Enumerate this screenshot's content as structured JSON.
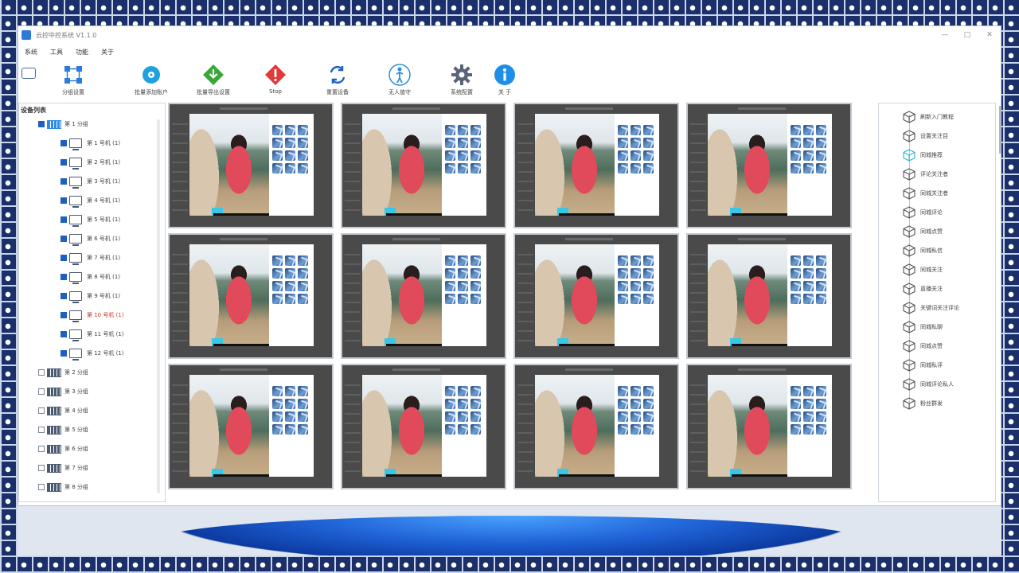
{
  "window": {
    "title": "云控中控系统 V1.1.0",
    "controls": [
      "—",
      "□",
      "✕"
    ]
  },
  "menu": [
    "系统",
    "工具",
    "功能",
    "关于"
  ],
  "toolbar": [
    {
      "id": "group",
      "label": "分组设置",
      "icon": "network-icon",
      "color": "#2d7bd8"
    },
    {
      "id": "batch-add",
      "label": "批量添加账户",
      "icon": "disc-icon",
      "color": "#1fa0e0"
    },
    {
      "id": "batch-export",
      "label": "批量导出设置",
      "icon": "download-diamond-icon",
      "color": "#3aa838"
    },
    {
      "id": "stop",
      "label": "Stop",
      "icon": "stop-diamond-icon",
      "color": "#e03a3a"
    },
    {
      "id": "reset",
      "label": "重置设备",
      "icon": "refresh-icon",
      "color": "#1f62c6"
    },
    {
      "id": "unmanned",
      "label": "无人值守",
      "icon": "person-icon",
      "color": "#2a8ee0"
    },
    {
      "id": "settings",
      "label": "系统配置",
      "icon": "gear-icon",
      "color": "#5a6478"
    },
    {
      "id": "about",
      "label": "关 于",
      "icon": "info-icon",
      "color": "#1f8ee6"
    }
  ],
  "device_panel": {
    "title": "设备列表",
    "group1": {
      "label": "第 1 分组"
    },
    "devices": [
      {
        "label": "第 1 号机 (1)"
      },
      {
        "label": "第 2 号机 (1)"
      },
      {
        "label": "第 3 号机 (1)"
      },
      {
        "label": "第 4 号机 (1)"
      },
      {
        "label": "第 5 号机 (1)"
      },
      {
        "label": "第 6 号机 (1)"
      },
      {
        "label": "第 7 号机 (1)"
      },
      {
        "label": "第 8 号机 (1)"
      },
      {
        "label": "第 9 号机 (1)"
      },
      {
        "label": "第 10 号机 (1)"
      },
      {
        "label": "第 11 号机 (1)"
      },
      {
        "label": "第 12 号机 (1)"
      }
    ],
    "groups": [
      {
        "label": "第 2 分组"
      },
      {
        "label": "第 3 分组"
      },
      {
        "label": "第 4 分组"
      },
      {
        "label": "第 5 分组"
      },
      {
        "label": "第 6 分组"
      },
      {
        "label": "第 7 分组"
      },
      {
        "label": "第 8 分组"
      }
    ]
  },
  "functions": [
    "刷新入门教程",
    "设置关注目",
    "同城推荐",
    "评论关注者",
    "同城关注者",
    "同城评论",
    "同城点赞",
    "同城私信",
    "同城关注",
    "直播关注",
    "关键词关注评论",
    "同城私聊",
    "同城点赞",
    "同城私评",
    "同城评论私人",
    "粉丝群发"
  ]
}
